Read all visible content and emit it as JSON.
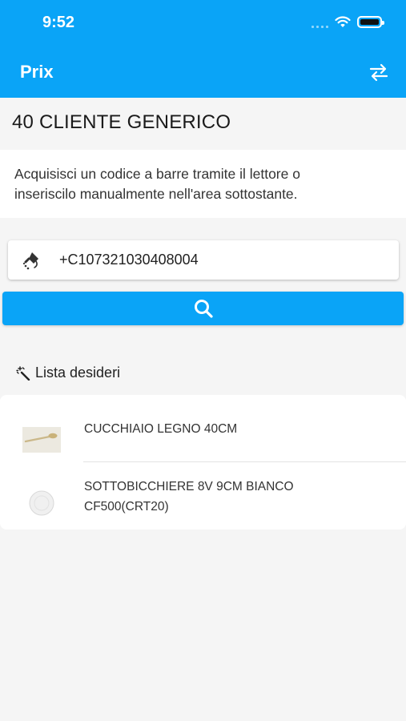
{
  "status_bar": {
    "time": "9:52",
    "icons": [
      "signal-icon",
      "wifi-icon",
      "battery-icon"
    ]
  },
  "header": {
    "title": "Prix",
    "action_icon": "swap-arrows-icon"
  },
  "customer": {
    "title": "40 CLIENTE GENERICO"
  },
  "instructions": {
    "line1": "Acquisisci un codice a barre tramite il lettore o",
    "line2": "inseriscilo manualmente nell'area sottostante."
  },
  "barcode": {
    "value": "+C107321030408004",
    "icon": "barcode-scanner-icon"
  },
  "search": {
    "icon": "search-icon"
  },
  "wishlist": {
    "title": "Lista desideri",
    "icon": "magic-wand-icon",
    "items": [
      {
        "name": "CUCCHIAIO LEGNO 40CM",
        "thumb": "wooden-spoon-image"
      },
      {
        "name_line1": "SOTTOBICCHIERE 8V 9CM BIANCO",
        "name_line2": "CF500(CRT20)",
        "thumb": "white-coaster-image"
      }
    ]
  },
  "colors": {
    "accent": "#0aa4f7",
    "background": "#f5f5f5"
  }
}
